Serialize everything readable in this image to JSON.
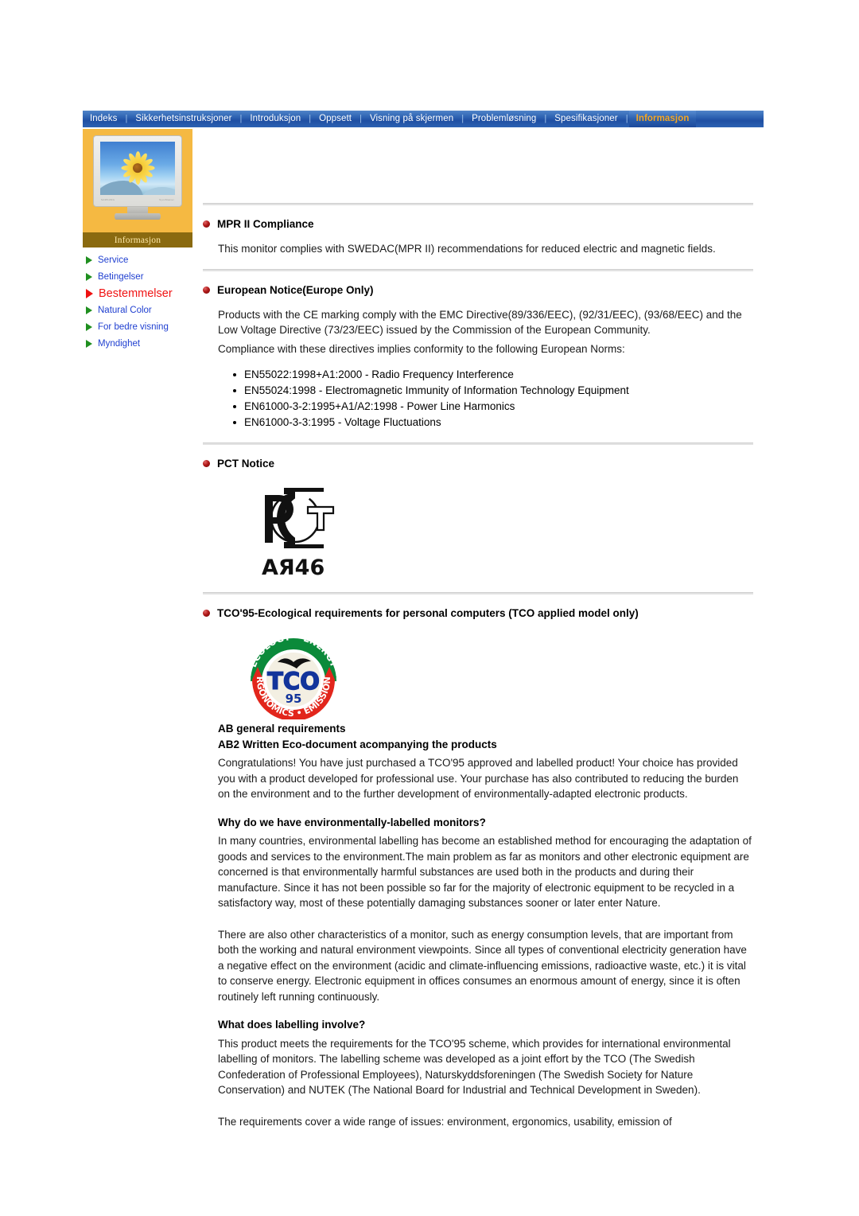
{
  "nav": {
    "items": [
      {
        "label": "Indeks",
        "active": false
      },
      {
        "label": "Sikkerhetsinstruksjoner",
        "active": false
      },
      {
        "label": "Introduksjon",
        "active": false
      },
      {
        "label": "Oppsett",
        "active": false
      },
      {
        "label": "Visning på skjermen",
        "active": false
      },
      {
        "label": "Problemløsning",
        "active": false
      },
      {
        "label": "Spesifikasjoner",
        "active": false
      },
      {
        "label": "Informasjon",
        "active": true
      }
    ],
    "separator": "|",
    "active_color": "#f5a623",
    "bar_color": "#2f64b3"
  },
  "sidebar": {
    "panel_color": "#f5b942",
    "title": "Informasjon",
    "title_bar_color": "#8a6a10",
    "items": [
      {
        "label": "Service",
        "current": false
      },
      {
        "label": "Betingelser",
        "current": false
      },
      {
        "label": "Bestemmelser",
        "current": true
      },
      {
        "label": "Natural Color",
        "current": false
      },
      {
        "label": "For bedre visning",
        "current": false
      },
      {
        "label": "Myndighet",
        "current": false
      }
    ],
    "link_color": "#1f3fd0",
    "current_color": "#f01414",
    "monitor_brand_left": "SAMSUNG",
    "monitor_brand_right": "SyncMaster"
  },
  "content": {
    "sections": [
      {
        "id": "mpr",
        "title": "MPR II Compliance",
        "paragraphs": [
          "This monitor complies with SWEDAC(MPR II) recommendations for reduced electric and magnetic fields."
        ]
      },
      {
        "id": "european-notice",
        "title": "European Notice(Europe Only)",
        "paragraphs": [
          "Products with the CE marking comply with the EMC Directive(89/336/EEC), (92/31/EEC), (93/68/EEC) and the Low Voltage Directive (73/23/EEC) issued by the Commission of the European Community.",
          "Compliance with these directives implies conformity to the following European Norms:"
        ],
        "norms": [
          "EN55022:1998+A1:2000 - Radio Frequency Interference",
          "EN55024:1998 - Electromagnetic Immunity of Information Technology Equipment",
          "EN61000-3-2:1995+A1/A2:1998 - Power Line Harmonics",
          "EN61000-3-3:1995 - Voltage Fluctuations"
        ]
      },
      {
        "id": "pct",
        "title": "PCT Notice",
        "logo_caption": "AЯ46",
        "logo_letters": [
          "P",
          "C",
          "T"
        ]
      },
      {
        "id": "tco95",
        "title": "TCO'95-Ecological requirements for personal computers (TCO applied model only)"
      }
    ],
    "tco_logo": {
      "top_arc_text": "ECOLOGY • ENERGY",
      "bottom_arc_text": "ERGONOMICS • EMISSIONS",
      "center_text": "TCO",
      "year_text": "95",
      "green": "#0b8a3a",
      "red": "#e2261c",
      "blue": "#12349b"
    },
    "blocks": [
      {
        "id": "ab-general",
        "heading_1": "AB general requirements",
        "heading_2": "AB2 Written Eco-document acompanying the products",
        "body": "Congratulations! You have just purchased a TCO'95 approved and labelled product! Your choice has provided you with a product developed for professional use. Your purchase has also contributed to reducing the burden on the environment and to the further development of environmentally-adapted electronic products."
      },
      {
        "id": "why-labelled",
        "heading_1": "Why do we have environmentally-labelled monitors?",
        "body": "In many countries, environmental labelling has become an established method for encouraging the adaptation of goods and services to the environment.The main problem as far as monitors and other electronic equipment are concerned is that environmentally harmful substances are used both in the products and during their manufacture. Since it has not been possible so far for the majority of electronic equipment to be recycled in a satisfactory way, most of these potentially damaging substances sooner or later enter Nature."
      },
      {
        "id": "monitor-characteristics",
        "body": "There are also other characteristics of a monitor, such as energy consumption levels, that are important from both the working and natural environment viewpoints. Since all types of conventional electricity generation have a negative effect on the environment (acidic and climate-influencing emissions, radioactive waste, etc.) it is vital to conserve energy. Electronic equipment in offices consumes an enormous amount of energy, since it is often routinely left running continuously."
      },
      {
        "id": "what-does-labelling-involve",
        "heading_1": "What does labelling involve?",
        "body": "This product meets the requirements for the TCO'95 scheme, which provides for international environmental labelling of monitors. The labelling scheme was developed as a joint effort by the TCO (The Swedish Confederation of Professional Employees), Naturskyddsforeningen (The Swedish Society for Nature Conservation) and NUTEK (The National Board for Industrial and Technical Development in Sweden)."
      },
      {
        "id": "requirements-cover",
        "body": "The requirements cover a wide range of issues: environment, ergonomics, usability, emission of"
      }
    ]
  }
}
